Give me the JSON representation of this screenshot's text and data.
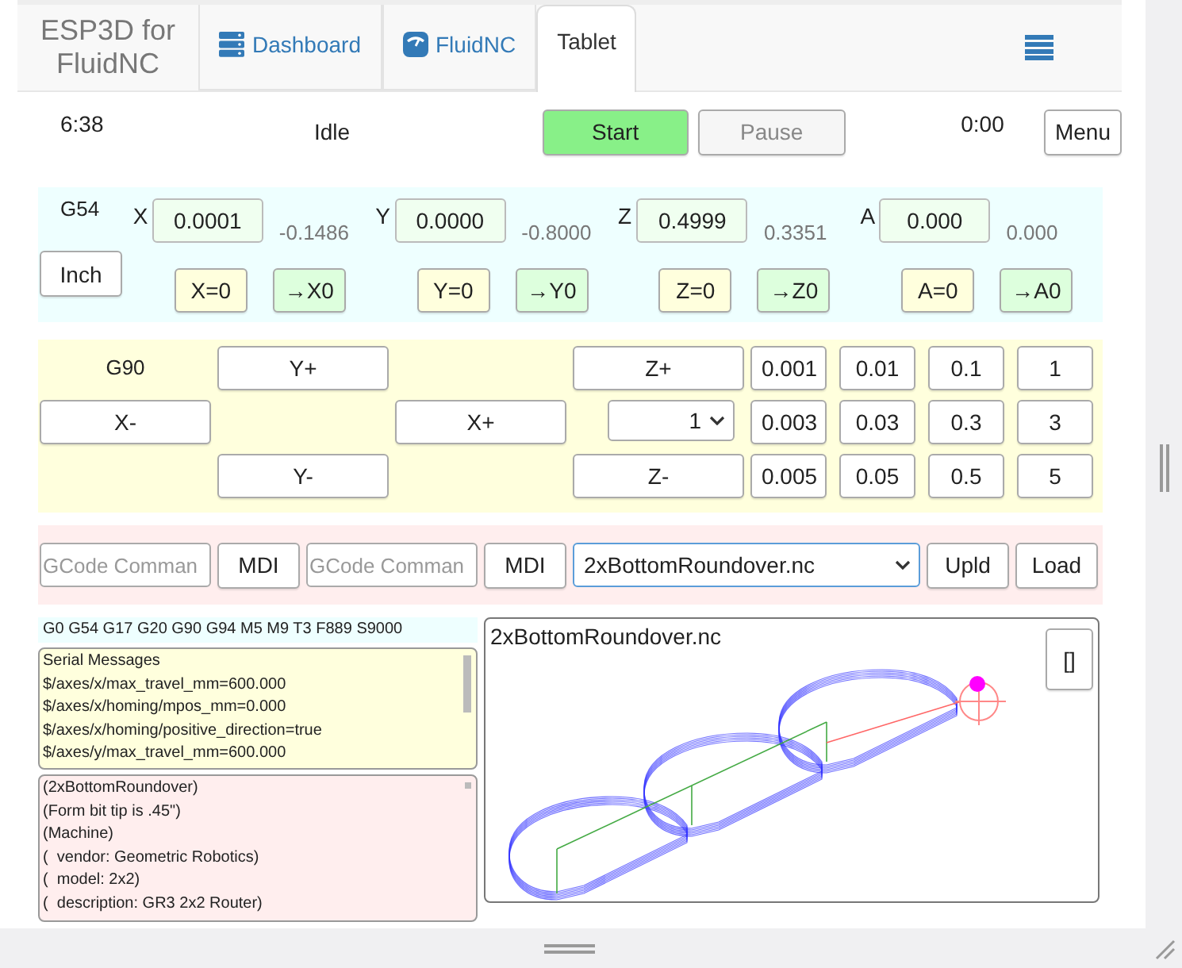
{
  "header": {
    "logo_lines": [
      "ESP3D for",
      "FluidNC"
    ],
    "tabs": [
      {
        "label": "Dashboard",
        "kind": "server",
        "selected": false
      },
      {
        "label": "FluidNC",
        "kind": "gauge",
        "selected": false
      },
      {
        "label": "Tablet",
        "selected": true
      }
    ]
  },
  "status": {
    "runtime": "6:38",
    "state": "Idle",
    "buttons": [
      {
        "label": "Start",
        "kind": "start",
        "disabled": false
      },
      {
        "label": "Pause",
        "kind": "pause",
        "disabled": true
      }
    ],
    "elapsed": "0:00",
    "menu": "Menu"
  },
  "axes": {
    "wcs": "G54",
    "units": "Inch",
    "items": [
      {
        "name": "X",
        "value": "0.0001",
        "machine": "-0.1486",
        "zero": "X=0",
        "goto": "→X0"
      },
      {
        "name": "Y",
        "value": "0.0000",
        "machine": "-0.8000",
        "zero": "Y=0",
        "goto": "→Y0"
      },
      {
        "name": "Z",
        "value": "0.4999",
        "machine": "0.3351",
        "zero": "Z=0",
        "goto": "→Z0"
      },
      {
        "name": "A",
        "value": "0.000",
        "machine": "0.000",
        "zero": "A=0",
        "goto": "→A0"
      }
    ]
  },
  "jog": {
    "mode": "G90",
    "buttons": [
      "Y+",
      "Z+",
      "X-",
      "X+",
      "Y-",
      "Z-"
    ],
    "multiplier": "1",
    "steps": [
      [
        "0.001",
        "0.01",
        "0.1",
        "1"
      ],
      [
        "0.003",
        "0.03",
        "0.3",
        "3"
      ],
      [
        "0.005",
        "0.05",
        "0.5",
        "5"
      ]
    ]
  },
  "mdi": {
    "commands": [
      {
        "placeholder": "GCode Comman",
        "button": "MDI"
      },
      {
        "placeholder": "GCode Comman",
        "button": "MDI"
      }
    ],
    "file": "2xBottomRoundover.nc",
    "upload": "Upld",
    "load": "Load"
  },
  "gcode_state": "G0 G54 G17 G20 G90 G94 M5 M9 T3 F889 S9000",
  "serial": {
    "title": "Serial Messages",
    "lines": [
      "$/axes/x/max_travel_mm=600.000",
      "$/axes/x/homing/mpos_mm=0.000",
      "$/axes/x/homing/positive_direction=true",
      "$/axes/y/max_travel_mm=600.000"
    ]
  },
  "gcode_lines": [
    "(2xBottomRoundover)",
    "(Form bit tip is .45\")",
    "(Machine)",
    "(  vendor: Geometric Robotics)",
    "(  model: 2x2)",
    "(  description: GR3 2x2 Router)"
  ],
  "preview": {
    "title": "2xBottomRoundover.nc",
    "fit_button": "[]"
  }
}
